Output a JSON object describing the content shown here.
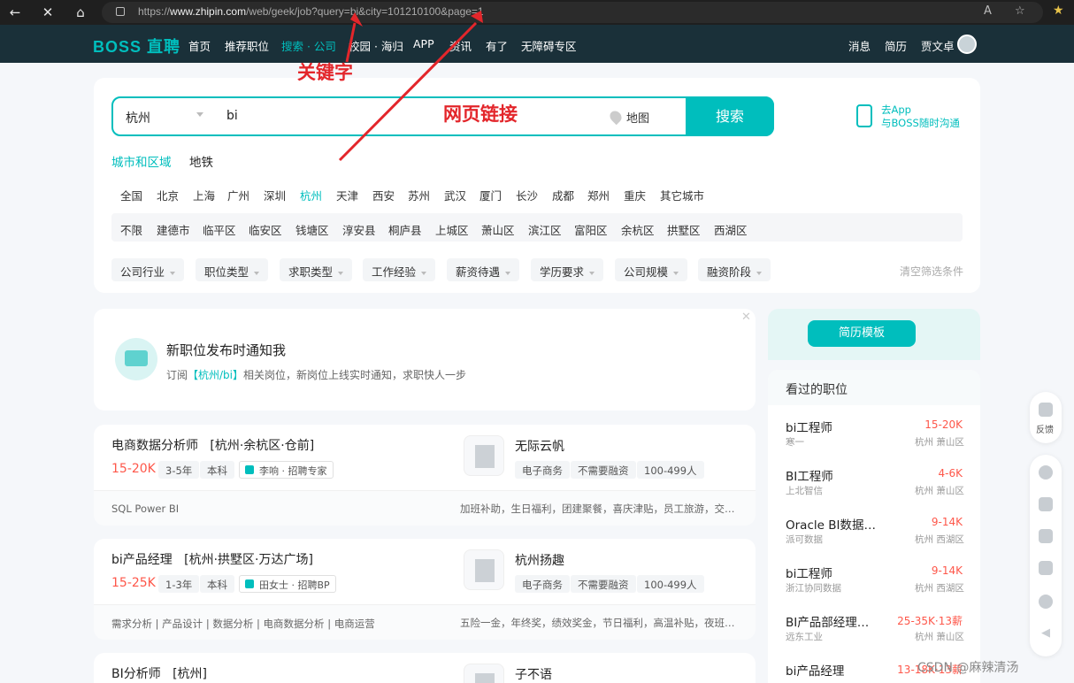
{
  "browser": {
    "url_prefix": "https://",
    "url_host": "www.zhipin.com",
    "url_path": "/web/geek/job?query=bi&city=101210100&page=1"
  },
  "nav": {
    "logo": "BOSS 直聘",
    "links": [
      "首页",
      "推荐职位",
      "搜索 · 公司",
      "校园 · 海归",
      "APP",
      "资讯",
      "有了",
      "无障碍专区"
    ],
    "right": [
      "消息",
      "简历",
      "贾文卓"
    ]
  },
  "search": {
    "city": "杭州",
    "query": "bi",
    "map_label": "地图",
    "button": "搜索"
  },
  "annotations": {
    "keyword": "关键字",
    "link": "网页链接"
  },
  "app_promo": {
    "line1": "去App",
    "line2": "与BOSS随时沟通"
  },
  "tabs": [
    "城市和区域",
    "地铁"
  ],
  "cities": [
    "全国",
    "北京",
    "上海",
    "广州",
    "深圳",
    "杭州",
    "天津",
    "西安",
    "苏州",
    "武汉",
    "厦门",
    "长沙",
    "成都",
    "郑州",
    "重庆",
    "其它城市"
  ],
  "districts": [
    "不限",
    "建德市",
    "临平区",
    "临安区",
    "钱塘区",
    "淳安县",
    "桐庐县",
    "上城区",
    "萧山区",
    "滨江区",
    "富阳区",
    "余杭区",
    "拱墅区",
    "西湖区"
  ],
  "filters": [
    "公司行业",
    "职位类型",
    "求职类型",
    "工作经验",
    "薪资待遇",
    "学历要求",
    "公司规模",
    "融资阶段"
  ],
  "clear_filters": "清空筛选条件",
  "notify": {
    "title": "新职位发布时通知我",
    "desc_prefix": "订阅",
    "desc_tag": "【杭州/bi】",
    "desc_suffix": "相关岗位，新岗位上线实时通知，求职快人一步"
  },
  "jobs": [
    {
      "title": "电商数据分析师",
      "location": "[杭州·余杭区·仓前]",
      "salary": "15-20K",
      "tags": [
        "3-5年",
        "本科"
      ],
      "recruiter": "李响 · 招聘专家",
      "company": "无际云帆",
      "company_tags": [
        "电子商务",
        "不需要融资",
        "100-499人"
      ],
      "skills": "SQL    Power BI",
      "benefits": "加班补助，生日福利，团建聚餐，喜庆津贴，员工旅游，交…"
    },
    {
      "title": "bi产品经理",
      "location": "[杭州·拱墅区·万达广场]",
      "salary": "15-25K",
      "tags": [
        "1-3年",
        "本科"
      ],
      "recruiter": "田女士 · 招聘BP",
      "company": "杭州扬趣",
      "company_tags": [
        "电子商务",
        "不需要融资",
        "100-499人"
      ],
      "skills": "需求分析  |  产品设计  |  数据分析  |  电商数据分析  |  电商运营",
      "benefits": "五险一金，年终奖，绩效奖金，节日福利，高温补贴，夜班…"
    },
    {
      "title": "BI分析师",
      "location": "[杭州]",
      "company": "子不语"
    }
  ],
  "right_panel": {
    "template_button": "简历模板",
    "viewed_title": "看过的职位",
    "items": [
      {
        "title": "bi工程师",
        "salary": "15-20K",
        "company": "寒一",
        "loc": "杭州 萧山区"
      },
      {
        "title": "BI工程师",
        "salary": "4-6K",
        "company": "上北智信",
        "loc": "杭州 萧山区"
      },
      {
        "title": "Oracle BI数据…",
        "salary": "9-14K",
        "company": "派可数据",
        "loc": "杭州 西湖区"
      },
      {
        "title": "bi工程师",
        "salary": "9-14K",
        "company": "浙江协同数据",
        "loc": "杭州 西湖区"
      },
      {
        "title": "BI产品部经理…",
        "salary": "25-35K·13薪",
        "company": "远东工业",
        "loc": "杭州 萧山区"
      },
      {
        "title": "bi产品经理",
        "salary": "13-18K·13薪",
        "company": "",
        "loc": ""
      }
    ]
  },
  "float": {
    "feedback": "反馈"
  },
  "watermark": "CSDN @麻辣清汤",
  "colors": {
    "brand": "#00bebd",
    "salary": "#fe574a",
    "annotation": "#e3262b",
    "nav_bg": "#1a3039"
  }
}
